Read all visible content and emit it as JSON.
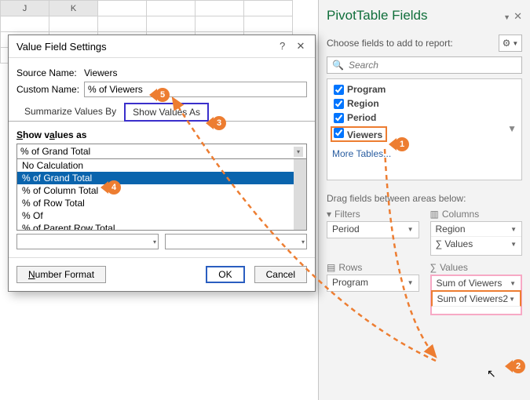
{
  "spreadsheet": {
    "colJ": "J",
    "colK": "K"
  },
  "pivot": {
    "title": "PivotTable Fields",
    "choose_label": "Choose fields to add to report:",
    "search_placeholder": "Search",
    "fields": [
      {
        "label": "Program",
        "checked": true
      },
      {
        "label": "Region",
        "checked": true
      },
      {
        "label": "Period",
        "checked": true
      },
      {
        "label": "Viewers",
        "checked": true
      }
    ],
    "more_tables": "More Tables...",
    "drag_label": "Drag fields between areas below:",
    "areas": {
      "filters_hdr": "Filters",
      "columns_hdr": "Columns",
      "rows_hdr": "Rows",
      "values_hdr": "Values",
      "filters": [
        "Period"
      ],
      "columns": [
        "Region",
        "∑ Values"
      ],
      "rows": [
        "Program"
      ],
      "values": [
        "Sum of Viewers",
        "Sum of Viewers2"
      ]
    }
  },
  "dialog": {
    "title": "Value Field Settings",
    "source_label": "Source Name:",
    "source_value": "Viewers",
    "custom_label": "Custom Name:",
    "custom_value": "% of Viewers",
    "tab1": "Summarize Values By",
    "tab2": "Show Values As",
    "section": "Show values as",
    "selected": "% of Grand Total",
    "options": [
      "No Calculation",
      "% of Grand Total",
      "% of Column Total",
      "% of Row Total",
      "% Of",
      "% of Parent Row Total"
    ],
    "number_format": "Number Format",
    "ok": "OK",
    "cancel": "Cancel"
  },
  "callouts": {
    "c1": "1",
    "c2": "2",
    "c3": "3",
    "c4": "4",
    "c5": "5"
  }
}
